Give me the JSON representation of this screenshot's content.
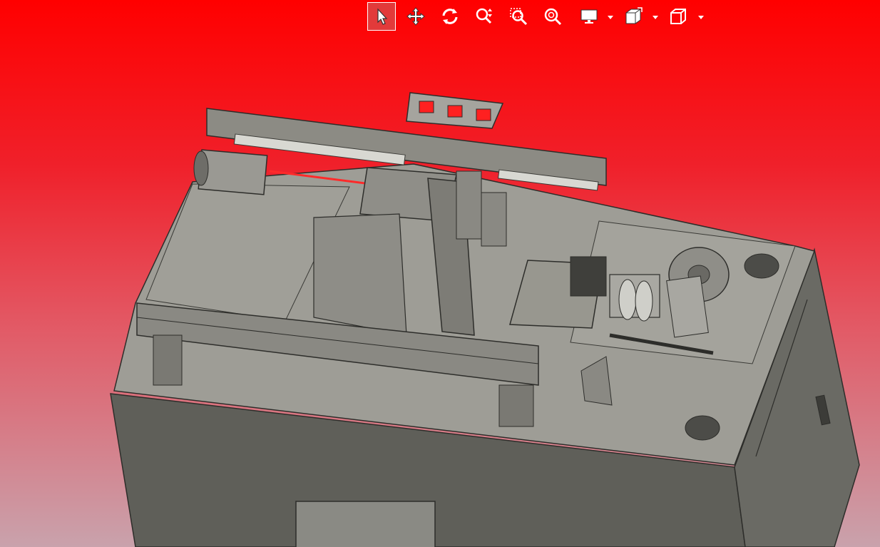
{
  "viewer": {
    "background_top_color": "#ff0000",
    "background_bottom_color": "#c9a2ac",
    "model_body_color": "#5e5e58",
    "model_plate_color": "#9d9c95"
  },
  "toolbar": {
    "active_tool": "select",
    "tools": [
      {
        "name": "select",
        "icon": "cursor-arrow-icon"
      },
      {
        "name": "pan",
        "icon": "move-arrows-icon"
      },
      {
        "name": "rotate",
        "icon": "rotate-icon"
      },
      {
        "name": "zoom",
        "icon": "zoom-updown-icon"
      },
      {
        "name": "zoom-window",
        "icon": "zoom-window-icon"
      },
      {
        "name": "zoom-fit",
        "icon": "zoom-fit-icon"
      },
      {
        "name": "display-mode",
        "icon": "monitor-icon",
        "has_dropdown": true
      },
      {
        "name": "section-view",
        "icon": "section-box-icon",
        "has_dropdown": true
      },
      {
        "name": "standard-views",
        "icon": "cube-icon",
        "has_dropdown": true
      }
    ]
  }
}
